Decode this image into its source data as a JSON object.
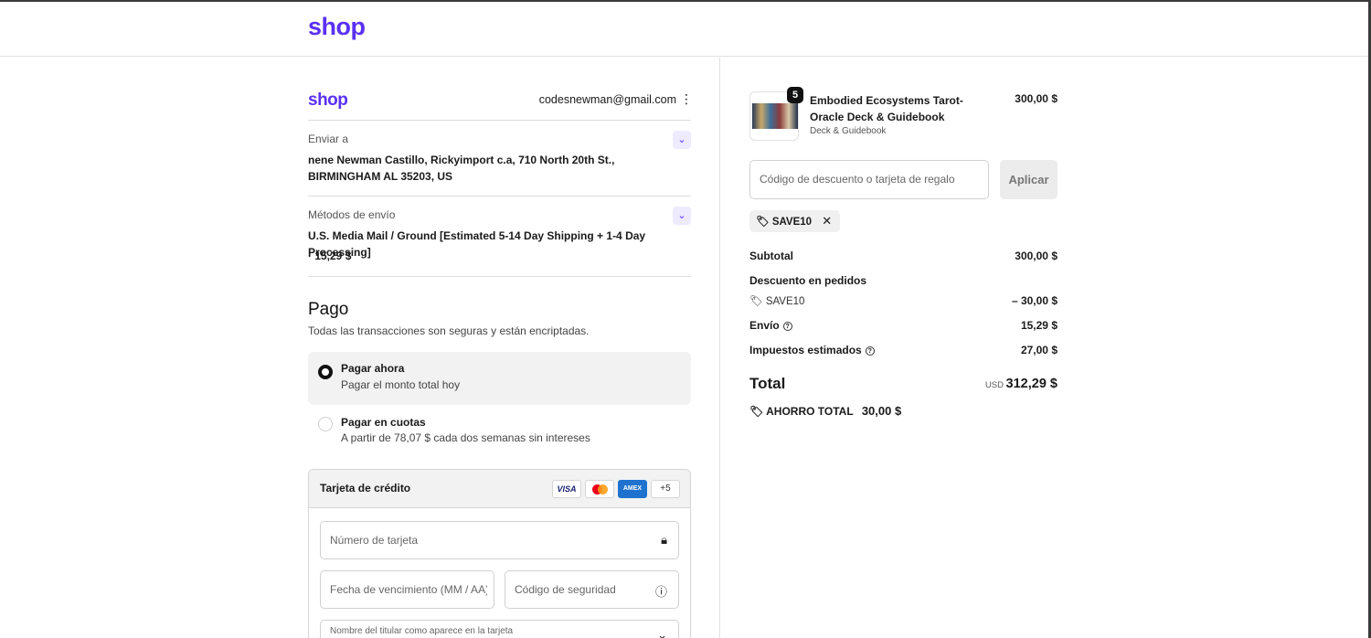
{
  "header": {
    "logo": "shop"
  },
  "account": {
    "logo": "shop",
    "email": "codesnewman@gmail.com",
    "menu_icon": "kebab-icon"
  },
  "shipping": {
    "label": "Enviar a",
    "value": "nene Newman Castillo, Rickyimport c.a, 710 North 20th St., BIRMINGHAM AL 35203, US"
  },
  "shipping_method": {
    "label": "Métodos de envío",
    "value_line1": "U.S. Media Mail / Ground [Estimated 5-14 Day Shipping + 1-4 Day Processing]",
    "value_line2": "· 15,29 $"
  },
  "payment": {
    "title": "Pago",
    "subtitle": "Todas las transacciones son seguras y están encriptadas.",
    "options": [
      {
        "title": "Pagar ahora",
        "subtitle": "Pagar el monto total hoy",
        "selected": true
      },
      {
        "title": "Pagar en cuotas",
        "subtitle": "A partir de 78,07 $ cada dos semanas sin intereses",
        "selected": false
      }
    ],
    "card": {
      "title": "Tarjeta de crédito",
      "brands": [
        "VISA",
        "mastercard",
        "AMEX",
        "+5"
      ],
      "number_placeholder": "Número de tarjeta",
      "expiry_placeholder": "Fecha de vencimiento (MM / AA)",
      "cvv_placeholder": "Código de seguridad",
      "name_label": "Nombre del titular como aparece en la tarjeta"
    }
  },
  "order": {
    "product": {
      "name": "Embodied Ecosystems Tarot-Oracle Deck & Guidebook",
      "variant": "Deck & Guidebook",
      "quantity": "5",
      "price": "300,00 $"
    },
    "discount": {
      "placeholder": "Código de descuento o tarjeta de regalo",
      "apply_label": "Aplicar",
      "applied_code": "SAVE10"
    },
    "summary": {
      "subtotal_label": "Subtotal",
      "subtotal_value": "300,00 $",
      "order_discount_label": "Descuento en pedidos",
      "discount_code": "SAVE10",
      "discount_value": "– 30,00 $",
      "shipping_label": "Envío",
      "shipping_value": "15,29 $",
      "taxes_label": "Impuestos estimados",
      "taxes_value": "27,00 $",
      "total_label": "Total",
      "currency": "USD",
      "total_value": "312,29 $",
      "savings_label": "AHORRO TOTAL",
      "savings_value": "30,00 $"
    }
  }
}
